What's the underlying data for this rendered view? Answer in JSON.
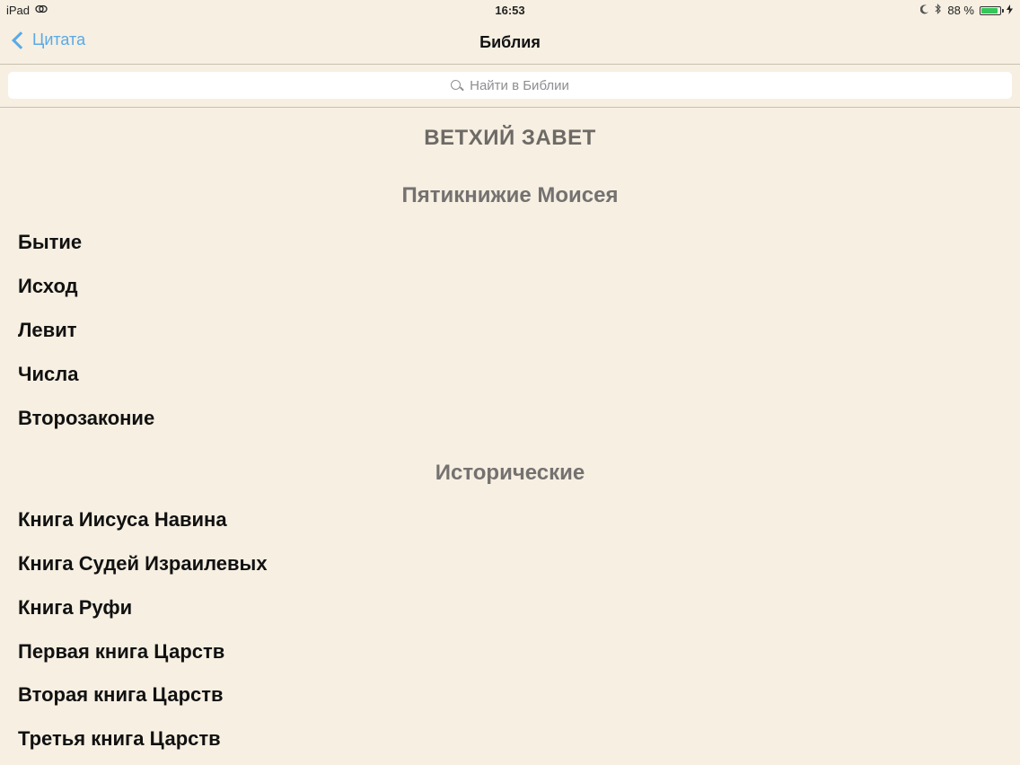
{
  "status_bar": {
    "device": "iPad",
    "time": "16:53",
    "battery_percent": "88 %",
    "battery_level": 0.88
  },
  "nav": {
    "back_label": "Цитата",
    "title": "Библия"
  },
  "search": {
    "placeholder": "Найти в Библии"
  },
  "testament": {
    "title": "ВЕТХИЙ ЗАВЕТ"
  },
  "sections": [
    {
      "header": "Пятикнижие Моисея",
      "books": [
        "Бытие",
        "Исход",
        "Левит",
        "Числа",
        "Второзаконие"
      ]
    },
    {
      "header": "Исторические",
      "books": [
        "Книга Иисуса Навина",
        "Книга Судей Израилевых",
        "Книга Руфи",
        "Первая книга Царств",
        "Вторая книга Царств",
        "Третья книга Царств"
      ]
    }
  ],
  "colors": {
    "background": "#f6efe2",
    "accent": "#5aa9e6",
    "section_header": "#747170",
    "battery": "#35c759"
  },
  "icons": {
    "status_left": "sync-icon",
    "status_right": [
      "moon-icon",
      "bluetooth-icon",
      "battery-icon",
      "charging-icon"
    ],
    "search": "search-icon",
    "back": "chevron-left-icon"
  }
}
